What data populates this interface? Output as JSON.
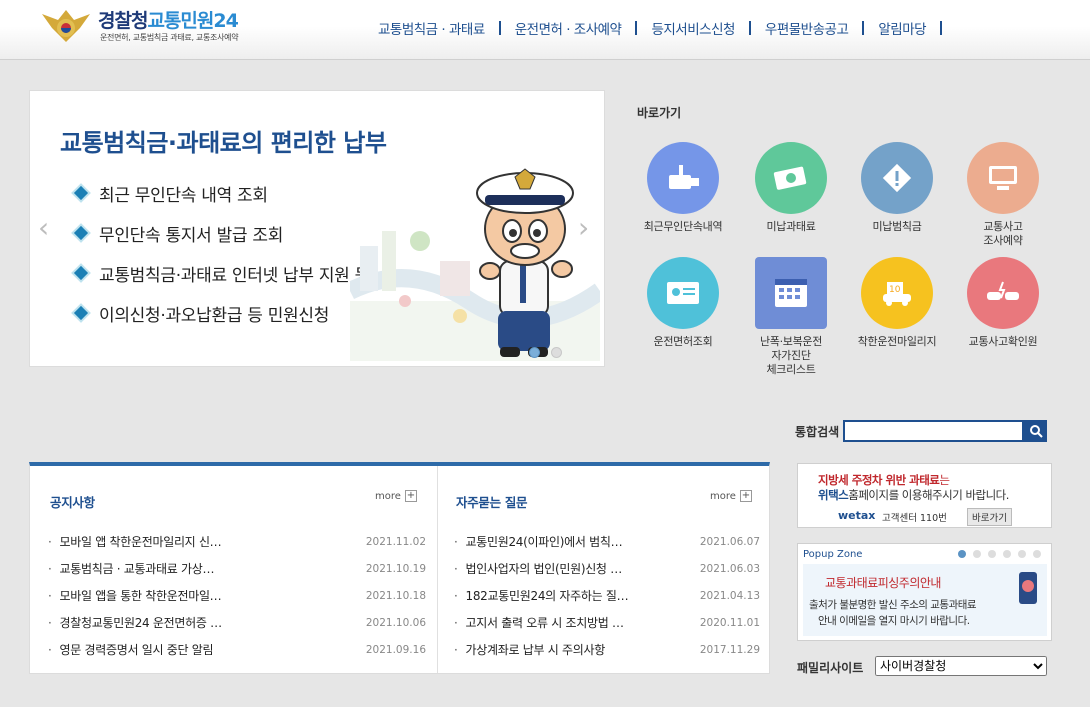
{
  "header": {
    "logo_title_a": "경찰청",
    "logo_title_b": "교통민원24",
    "logo_sub": "운전면허, 교통범칙금 과태료, 교통조사예약",
    "nav": [
      "교통범칙금 · 과태료",
      "운전면허 · 조사예약",
      "등지서비스신청",
      "우편물반송공고",
      "알림마당"
    ]
  },
  "banner": {
    "title": "교통범칙금·과태료의 편리한 납부",
    "items": [
      "최근 무인단속 내역 조회",
      "무인단속 통지서 발급 조회",
      "교통범칙금·과태료 인터넷 납부 지원 등",
      "이의신청·과오납환급 등 민원신청"
    ],
    "prev": "‹",
    "next": "›"
  },
  "quick": {
    "title": "바로가기",
    "items": [
      {
        "label": "최근무인단속내역",
        "color": "#7596e8",
        "icon": "camera-icon"
      },
      {
        "label": "미납과태료",
        "color": "#5fc89a",
        "icon": "money-icon"
      },
      {
        "label": "미납범칙금",
        "color": "#74a2c9",
        "icon": "warning-icon"
      },
      {
        "label": "교통사고\n조사예약",
        "color": "#ecac8f",
        "icon": "monitor-icon"
      },
      {
        "label": "운전면허조회",
        "color": "#4fc1d9",
        "icon": "license-icon"
      },
      {
        "label": "난폭·보복운전\n자가진단\n체크리스트",
        "color": "#6f8dd6",
        "icon": "calendar-check-icon"
      },
      {
        "label": "착한운전마일리지",
        "color": "#f6c21f",
        "icon": "mileage-icon"
      },
      {
        "label": "교통사고확인원",
        "color": "#e9787d",
        "icon": "crash-icon"
      }
    ]
  },
  "search": {
    "label": "통합검색",
    "value": ""
  },
  "notice": {
    "title": "공지사항",
    "more": "more",
    "posts": [
      {
        "title": "모바일 앱 착한운전마일리지 신…",
        "date": "2021.11.02"
      },
      {
        "title": "교통범칙금 · 교통과태료 가상…",
        "date": "2021.10.19"
      },
      {
        "title": "모바일 앱을 통한 착한운전마일…",
        "date": "2021.10.18"
      },
      {
        "title": "경찰청교통민원24 운전면허증 …",
        "date": "2021.10.06"
      },
      {
        "title": "영문 경력증명서 일시 중단 알림",
        "date": "2021.09.16"
      }
    ]
  },
  "faq": {
    "title": "자주묻는 질문",
    "more": "more",
    "posts": [
      {
        "title": "교통민원24(이파인)에서 범칙…",
        "date": "2021.06.07"
      },
      {
        "title": "법인사업자의 법인(민원)신청 …",
        "date": "2021.06.03"
      },
      {
        "title": "182교통민원24의 자주하는 질…",
        "date": "2021.04.13"
      },
      {
        "title": "고지서 출력 오류 시 조치방법 …",
        "date": "2020.11.01"
      },
      {
        "title": "가상계좌로 납부 시 주의사항",
        "date": "2017.11.29"
      }
    ]
  },
  "ad": {
    "line1_bold": "지방세 주정차 위반 과태료",
    "line1_rest": "는",
    "line2_bold": "위택스",
    "line2_rest": "홈페이지를 이용해주시기 바랍니다.",
    "brand": "wetax",
    "tel": "고객센터 110번",
    "go": "바로가기"
  },
  "popup": {
    "title": "Popup Zone",
    "banner_title": "교통과태료피싱주의안내",
    "line1": "출처가 불분명한 발신 주소의 교통과태료",
    "line2": "안내 이메일을 열지 마시기 바랍니다.",
    "count": 6
  },
  "family": {
    "label": "패밀리사이트",
    "selected": "사이버경찰청"
  }
}
